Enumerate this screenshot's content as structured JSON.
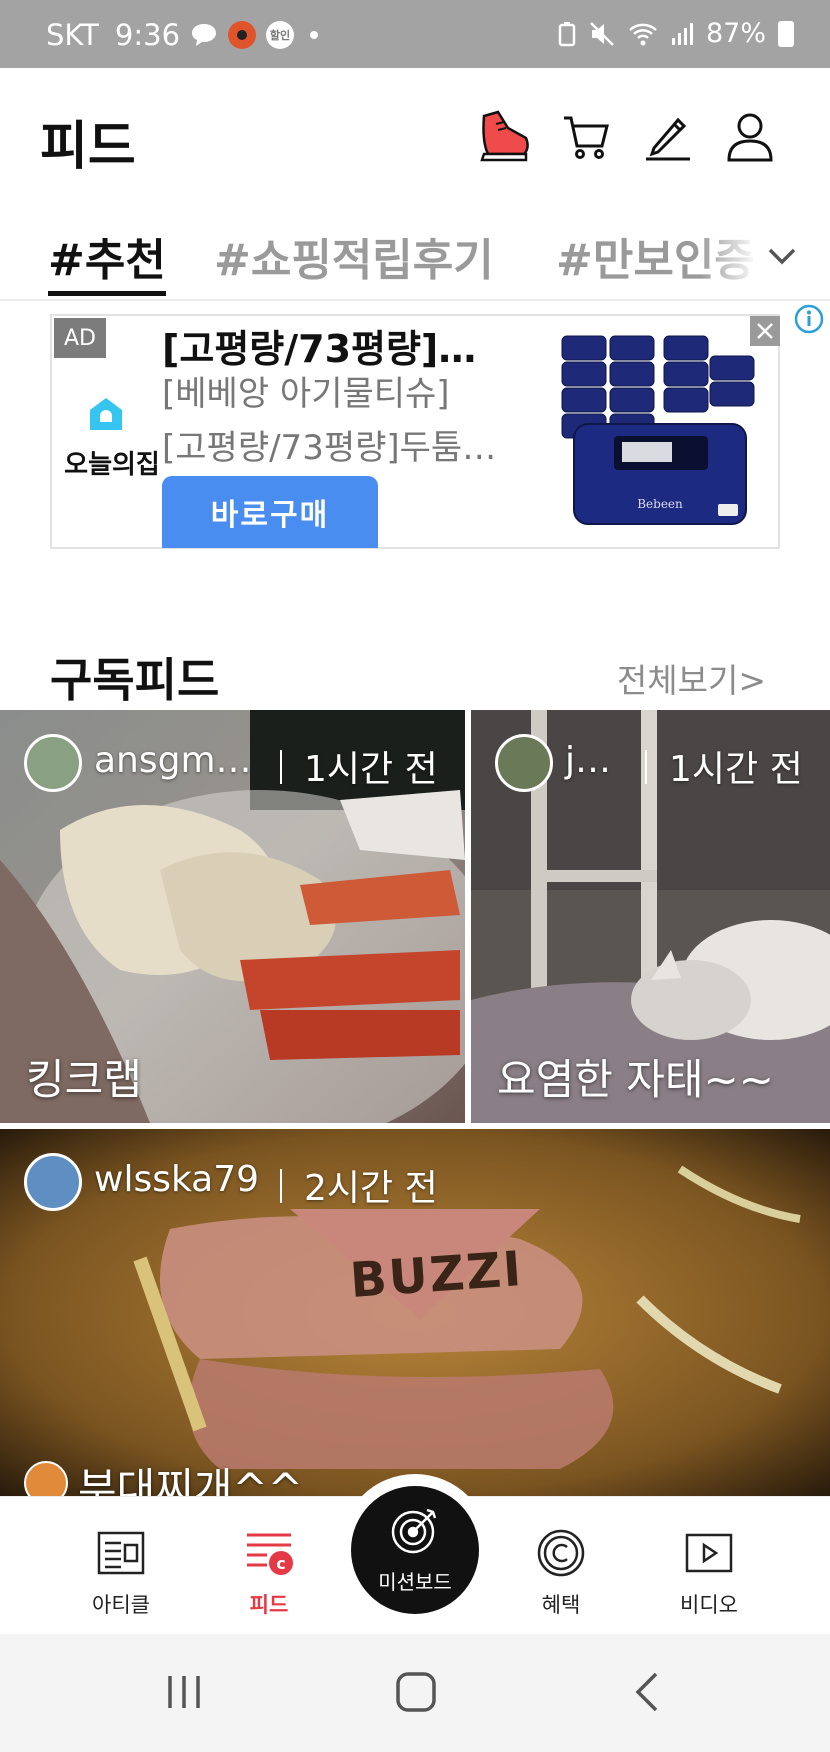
{
  "status_bar": {
    "carrier": "SKT",
    "time": "9:36",
    "badge": "할인",
    "battery": "87%"
  },
  "header": {
    "title": "피드",
    "icons": [
      "sneaker-icon",
      "cart-icon",
      "pencil-icon",
      "profile-icon"
    ]
  },
  "tabs": {
    "items": [
      "#추천",
      "#쇼핑적립후기",
      "#만보인증"
    ],
    "active_index": 0
  },
  "ad": {
    "label": "AD",
    "brand": "오늘의집",
    "title": "[고평량/73평량]…",
    "line1": "[베베앙 아기물티슈]",
    "line2": "[고평량/73평량]두툼…",
    "button": "바로구매",
    "accent": "#4a8df0"
  },
  "section": {
    "title": "구독피드",
    "link": "전체보기>"
  },
  "feed": [
    {
      "user": "ansgm…",
      "time": "1시간 전",
      "caption": "킹크랩"
    },
    {
      "user": "j…",
      "time": "1시간 전",
      "caption": "요염한 자태~~"
    },
    {
      "user": "wlsska79",
      "time": "2시간 전",
      "caption": "부대찌개^^",
      "overlay_text": "BUZZI"
    }
  ],
  "bottom_nav": {
    "items": [
      {
        "label": "아티클",
        "icon": "article-icon"
      },
      {
        "label": "피드",
        "icon": "feed-icon",
        "active": true
      },
      {
        "label": "미션보드",
        "icon": "target-icon"
      },
      {
        "label": "혜택",
        "icon": "coin-icon"
      },
      {
        "label": "비디오",
        "icon": "video-icon"
      }
    ],
    "active_color": "#e63946"
  }
}
